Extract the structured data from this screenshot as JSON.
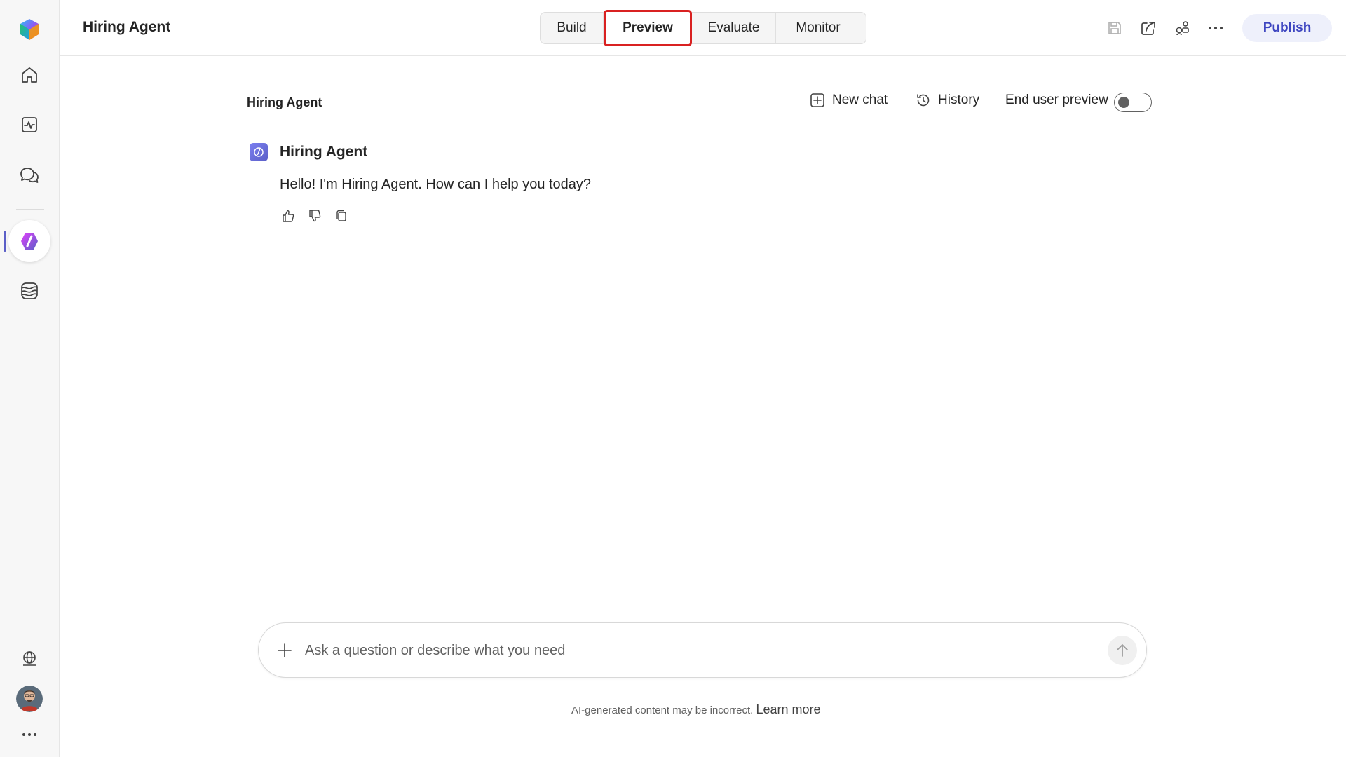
{
  "app": {
    "title": "Hiring Agent"
  },
  "tabs": [
    {
      "label": "Build",
      "active": false
    },
    {
      "label": "Preview",
      "active": true
    },
    {
      "label": "Evaluate",
      "active": false
    },
    {
      "label": "Monitor",
      "active": false
    }
  ],
  "toolbar": {
    "icons": [
      "save-icon",
      "share-icon",
      "connect-icon",
      "more-icon"
    ],
    "publish_label": "Publish"
  },
  "rail": {
    "items": [
      "copilot-logo",
      "home-icon",
      "analytics-icon",
      "chat-icon",
      "agent-icon",
      "model-icon"
    ],
    "bottom": [
      "globe-icon",
      "avatar",
      "more-icon"
    ]
  },
  "chat": {
    "title": "Hiring Agent",
    "new_chat_label": "New chat",
    "history_label": "History",
    "end_user_preview_label": "End user preview",
    "end_user_preview_on": false
  },
  "message": {
    "sender": "Hiring Agent",
    "text": "Hello! I'm Hiring Agent. How can I help you today?",
    "actions": [
      "thumbs-up-icon",
      "thumbs-down-icon",
      "copy-icon"
    ]
  },
  "composer": {
    "placeholder": "Ask a question or describe what you need",
    "value": ""
  },
  "footer": {
    "disclaimer": "AI-generated content may be incorrect.",
    "learn_more": "Learn more"
  },
  "colors": {
    "accent": "#5b5fc7",
    "publish_text": "#3d45c0",
    "publish_bg": "#eef0fb",
    "highlight": "#d92121"
  }
}
